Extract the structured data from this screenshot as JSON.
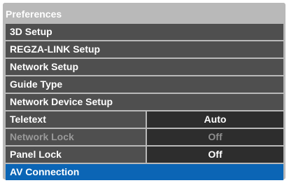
{
  "title": "Preferences",
  "items": [
    {
      "label": "3D Setup"
    },
    {
      "label": "REGZA-LINK Setup"
    },
    {
      "label": "Network Setup"
    },
    {
      "label": "Guide Type"
    },
    {
      "label": "Network Device Setup"
    },
    {
      "label": "Teletext",
      "value": "Auto"
    },
    {
      "label": "Network Lock",
      "value": "Off",
      "disabled": true
    },
    {
      "label": "Panel Lock",
      "value": "Off"
    },
    {
      "label": "AV Connection",
      "selected": true
    }
  ],
  "scroll_indicator": "▼",
  "colors": {
    "menu_bg": "#b9b9b9",
    "row_bg": "#4f4f4f",
    "value_bg": "#2d2d2d",
    "selected_bg": "#0b65b5",
    "disabled_text": "#9a9a9a"
  }
}
